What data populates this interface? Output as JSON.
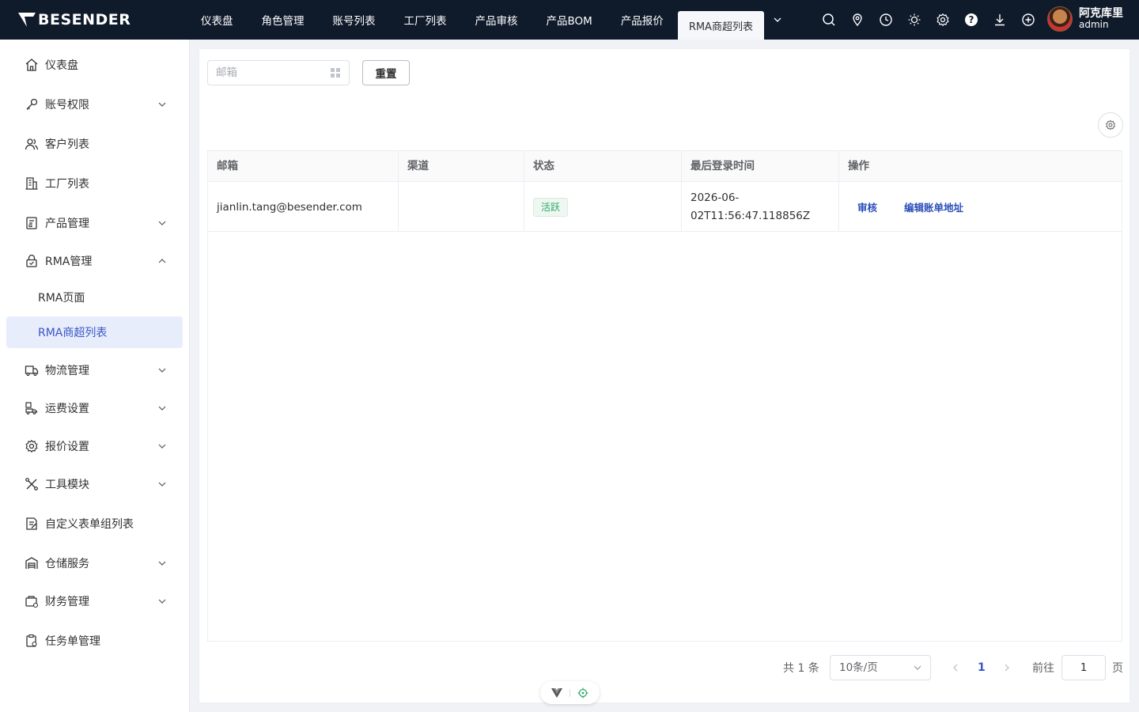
{
  "brand": {
    "name": "BESENDER"
  },
  "topnav": {
    "tabs": [
      "仪表盘",
      "角色管理",
      "账号列表",
      "工厂列表",
      "产品审核",
      "产品BOM",
      "产品报价",
      "RMA商超列表"
    ],
    "active_index": 7
  },
  "topicons": [
    "search-icon",
    "location-icon",
    "clock-icon",
    "sun-icon",
    "gear-icon",
    "help-icon",
    "download-icon",
    "plus-circle-icon"
  ],
  "user": {
    "name": "阿克库里",
    "role": "admin"
  },
  "sidebar": {
    "items": [
      {
        "label": "仪表盘",
        "icon": "home-icon",
        "has_children": false
      },
      {
        "label": "账号权限",
        "icon": "key-icon",
        "has_children": true
      },
      {
        "label": "客户列表",
        "icon": "users-icon",
        "has_children": false
      },
      {
        "label": "工厂列表",
        "icon": "building-icon",
        "has_children": false
      },
      {
        "label": "产品管理",
        "icon": "box-icon",
        "has_children": true
      },
      {
        "label": "RMA管理",
        "icon": "lock-icon",
        "has_children": true,
        "expanded": true
      },
      {
        "label": "RMA页面",
        "sub": true
      },
      {
        "label": "RMA商超列表",
        "sub": true,
        "active": true
      },
      {
        "label": "物流管理",
        "icon": "truck-icon",
        "has_children": true
      },
      {
        "label": "运费设置",
        "icon": "delivery-icon",
        "has_children": true
      },
      {
        "label": "报价设置",
        "icon": "settings-icon",
        "has_children": true
      },
      {
        "label": "工具模块",
        "icon": "tools-icon",
        "has_children": true
      },
      {
        "label": "自定义表单组列表",
        "icon": "form-icon",
        "has_children": false
      },
      {
        "label": "仓储服务",
        "icon": "warehouse-icon",
        "has_children": true
      },
      {
        "label": "财务管理",
        "icon": "wallet-icon",
        "has_children": true
      },
      {
        "label": "任务单管理",
        "icon": "clipboard-icon",
        "has_children": false
      }
    ]
  },
  "filter": {
    "email_placeholder": "邮箱",
    "reset_label": "重置"
  },
  "table": {
    "columns": [
      "邮箱",
      "渠道",
      "状态",
      "最后登录时间",
      "操作"
    ],
    "rows": [
      {
        "email": "jianlin.tang@besender.com",
        "channel": "",
        "status": "活跃",
        "time_line1": "2026-06-",
        "time_line2": "02T11:56:47.118856Z",
        "actions": [
          "审核",
          "编辑账单地址"
        ]
      }
    ]
  },
  "pagination": {
    "total_label": "共 1 条",
    "page_size": "10条/页",
    "current_page": "1",
    "goto_label": "前往",
    "goto_value": "1",
    "page_suffix": "页"
  },
  "colors": {
    "topbar": "#0f1a2b",
    "accent": "#3a57c8",
    "active_bg": "#e8edfb",
    "status_green": "#2fa86b"
  }
}
